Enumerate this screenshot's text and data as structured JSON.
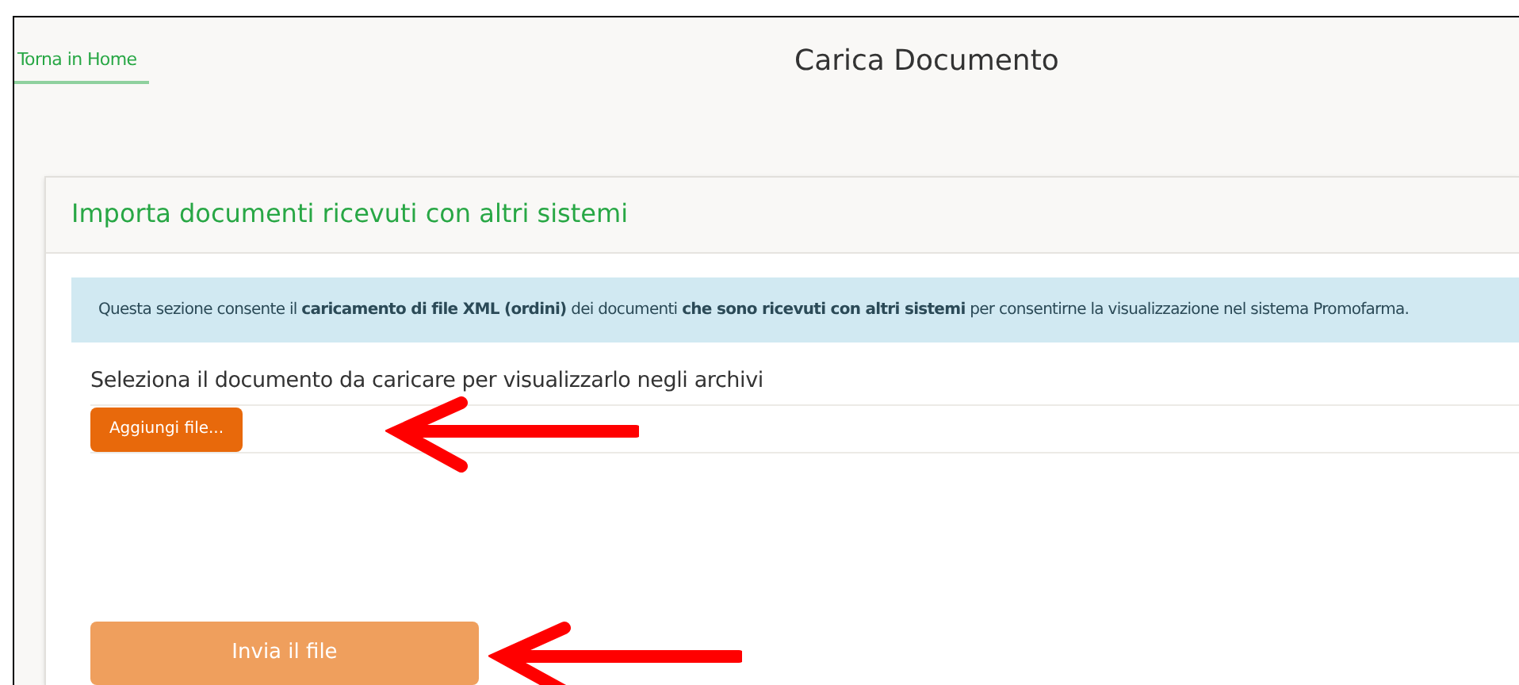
{
  "back_link": "Torna in Home",
  "title": "Carica Documento",
  "card": {
    "title": "Importa documenti ricevuti con altri sistemi",
    "info": "Questa sezione consente il **caricamento di file XML (ordini)** dei documenti **che sono ricevuti con altri sistemi** per consentirne la visualizzazione nel sistema Promofarma.",
    "label": "Seleziona il documento da caricare per visualizzarlo negli archivi",
    "add_button": "Aggiungi file...",
    "submit_button": {
      "label": "Invia il file",
      "disabled": true
    }
  }
}
